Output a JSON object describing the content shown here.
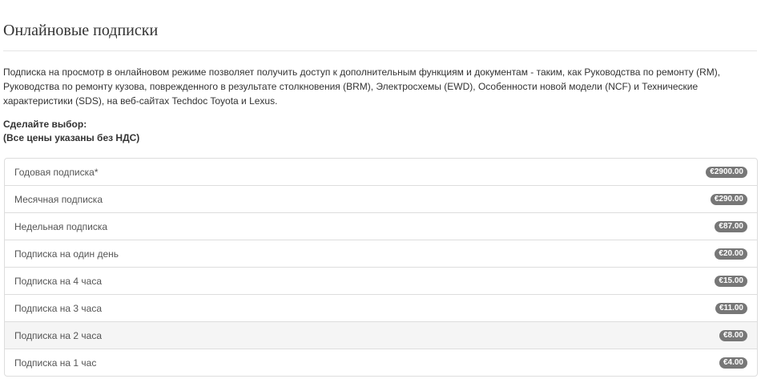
{
  "page": {
    "title": "Онлайновые подписки",
    "description": "Подписка на просмотр в онлайновом режиме позволяет получить доступ к дополнительным функциям и документам - таким, как Руководства по ремонту (RM), Руководства по ремонту кузова, поврежденного в результате столкновения (BRM), Электросхемы (EWD), Особенности новой модели (NCF) и Технические характеристики (SDS), на веб-сайтах Techdoc Toyota и Lexus.",
    "prompt_line1": "Сделайте выбор:",
    "prompt_line2": "(Все цены указаны без НДС)"
  },
  "subscriptions": [
    {
      "label": "Годовая подписка*",
      "price": "€2900.00"
    },
    {
      "label": "Месячная подписка",
      "price": "€290.00"
    },
    {
      "label": "Недельная подписка",
      "price": "€87.00"
    },
    {
      "label": "Подписка на один день",
      "price": "€20.00"
    },
    {
      "label": "Подписка на 4 часа",
      "price": "€15.00"
    },
    {
      "label": "Подписка на 3 часа",
      "price": "€11.00"
    },
    {
      "label": "Подписка на 2 часа",
      "price": "€8.00",
      "highlighted": true
    },
    {
      "label": "Подписка на 1 час",
      "price": "€4.00"
    }
  ],
  "colors": {
    "badge": "#777777",
    "highlight_row": "#f5f5f5",
    "border": "#dddddd"
  }
}
